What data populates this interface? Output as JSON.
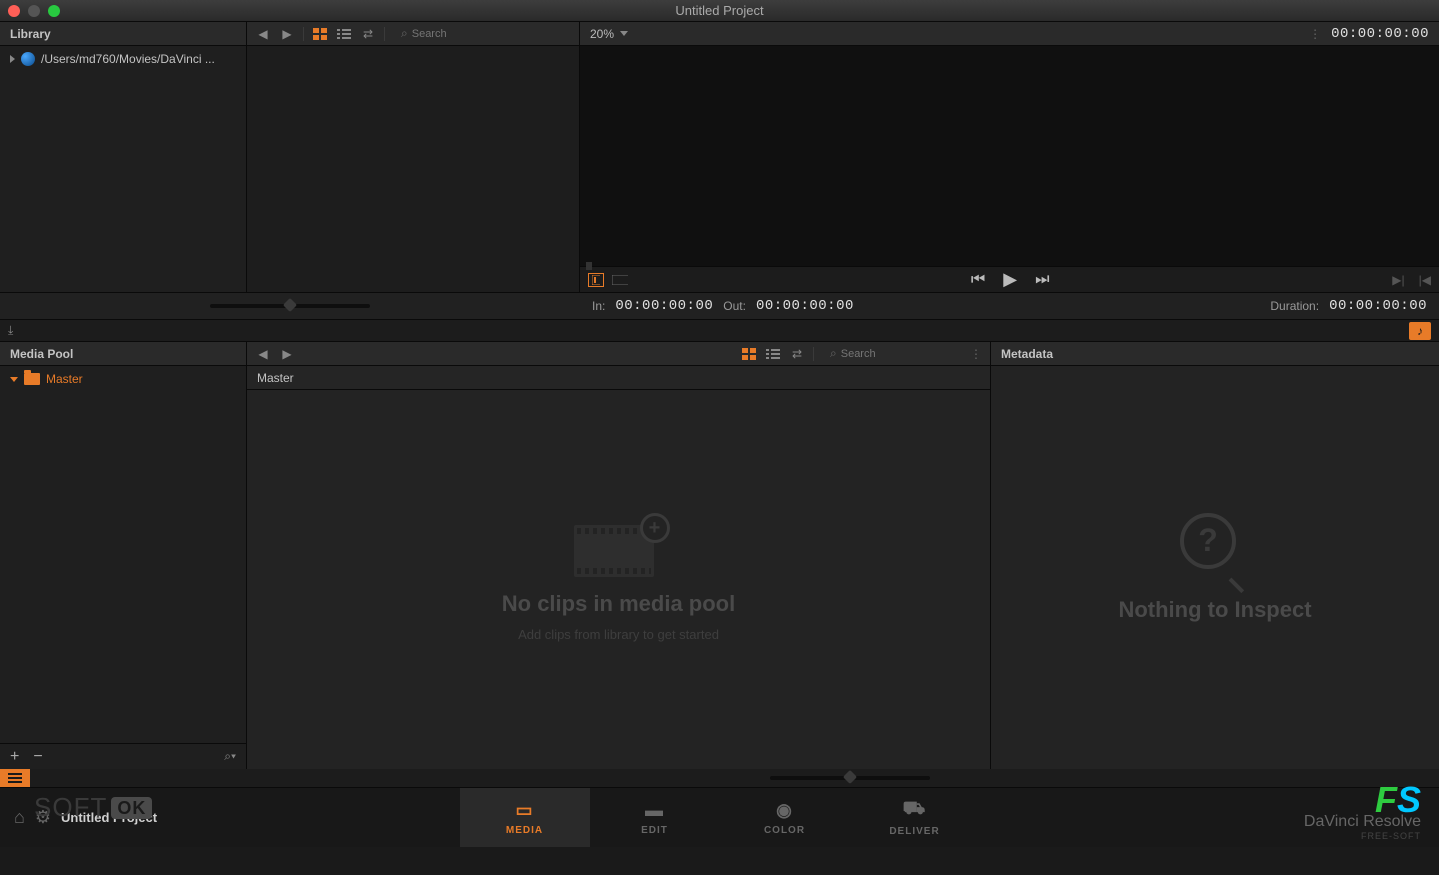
{
  "window": {
    "title": "Untitled Project"
  },
  "library": {
    "header": "Library",
    "path": "/Users/md760/Movies/DaVinci ..."
  },
  "browser": {
    "search_placeholder": "Search"
  },
  "viewer": {
    "zoom": "20%",
    "timecode_tr": "00:00:00:00",
    "in_label": "In:",
    "in_tc": "00:00:00:00",
    "out_label": "Out:",
    "out_tc": "00:00:00:00",
    "dur_label": "Duration:",
    "dur_tc": "00:00:00:00"
  },
  "mediapool": {
    "header": "Media Pool",
    "master": "Master",
    "search_placeholder": "Search",
    "empty_title": "No clips in media pool",
    "empty_sub": "Add clips from library to get started"
  },
  "metadata": {
    "header": "Metadata",
    "empty": "Nothing to Inspect"
  },
  "footer": {
    "project": "Untitled Project",
    "tabs": [
      {
        "id": "media",
        "label": "MEDIA"
      },
      {
        "id": "edit",
        "label": "EDIT"
      },
      {
        "id": "color",
        "label": "COLOR"
      },
      {
        "id": "deliver",
        "label": "DELIVER"
      }
    ],
    "brand": "DaVinci Resolve",
    "brand_sub": "FREE-SOFT"
  },
  "watermark": {
    "soft": "SOFT",
    "ok": "OK"
  }
}
